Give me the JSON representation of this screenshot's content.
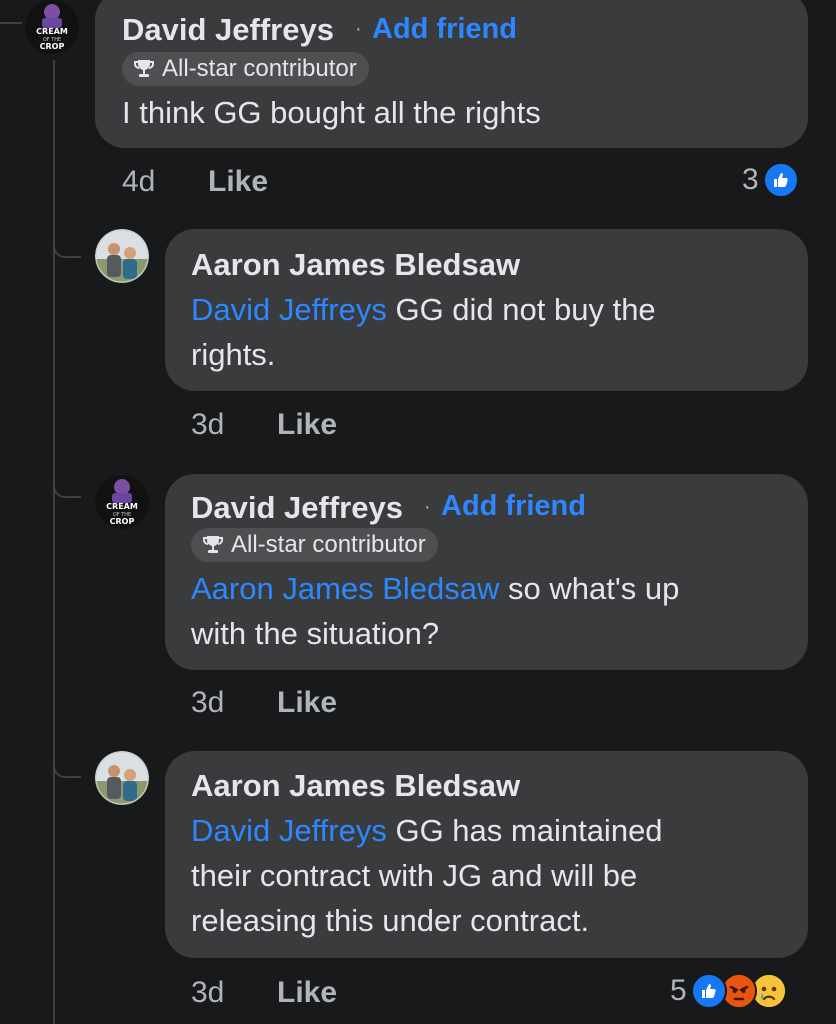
{
  "comments": [
    {
      "author": "David Jeffreys",
      "add_friend": "Add friend",
      "badge": "All-star contributor",
      "mention": "",
      "text": "I think GG bought all the rights",
      "time": "4d",
      "like": "Like",
      "reaction_count": "3",
      "reactions": [
        "like-icon"
      ]
    },
    {
      "author": "Aaron James Bledsaw",
      "mention": "David Jeffreys",
      "text_line1": " GG did not buy the",
      "text_line2": "rights.",
      "time": "3d",
      "like": "Like"
    },
    {
      "author": "David Jeffreys",
      "add_friend": "Add friend",
      "badge": "All-star contributor",
      "mention": "Aaron James Bledsaw",
      "text_line1": " so what's up",
      "text_line2": "with the situation?",
      "time": "3d",
      "like": "Like"
    },
    {
      "author": "Aaron James Bledsaw",
      "mention": "David Jeffreys",
      "text_line1": " GG has maintained",
      "text_line2": "their contract with JG and will be",
      "text_line3": "releasing this under contract.",
      "time": "3d",
      "like": "Like",
      "reaction_count": "5",
      "reactions": [
        "like-icon",
        "angry-icon",
        "sad-icon"
      ]
    }
  ],
  "avatar_logo": {
    "line1": "CREAM",
    "line2": "OF THE",
    "line3": "CROP"
  },
  "colors": {
    "background": "#18191a",
    "bubble": "#3a3b3c",
    "link": "#2d88ff",
    "muted": "#b0b3b8"
  }
}
